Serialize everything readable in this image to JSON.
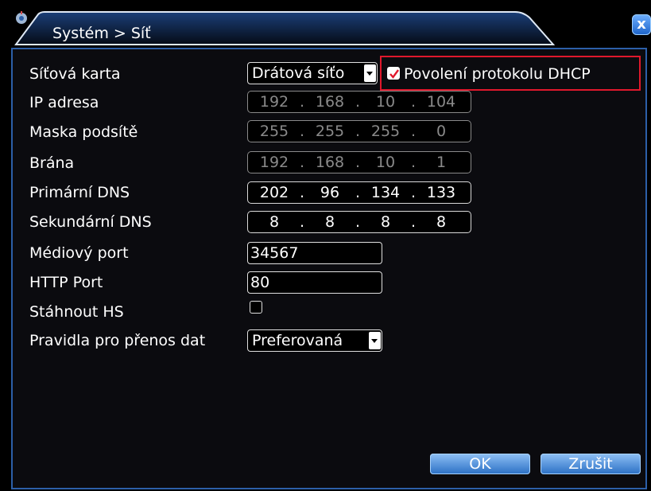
{
  "window": {
    "title": "Systém > Síť",
    "close_label": "x"
  },
  "form": {
    "network_card": {
      "label": "Síťová karta",
      "value": "Drátová síťo"
    },
    "dhcp": {
      "label": "Povolení protokolu DHCP",
      "checked": true
    },
    "ip_address": {
      "label": "IP adresa",
      "octets": [
        "192",
        "168",
        "10",
        "104"
      ],
      "enabled": false
    },
    "subnet_mask": {
      "label": "Maska podsítě",
      "octets": [
        "255",
        "255",
        "255",
        "0"
      ],
      "enabled": false
    },
    "gateway": {
      "label": "Brána",
      "octets": [
        "192",
        "168",
        "10",
        "1"
      ],
      "enabled": false
    },
    "primary_dns": {
      "label": "Primární DNS",
      "octets": [
        "202",
        "96",
        "134",
        "133"
      ],
      "enabled": true
    },
    "secondary_dns": {
      "label": "Sekundární DNS",
      "octets": [
        "8",
        "8",
        "8",
        "8"
      ],
      "enabled": true
    },
    "media_port": {
      "label": "Médiový port",
      "value": "34567"
    },
    "http_port": {
      "label": "HTTP Port",
      "value": "80"
    },
    "download_hs": {
      "label": "Stáhnout HS",
      "checked": false
    },
    "transfer_rules": {
      "label": "Pravidla pro přenos dat",
      "value": "Preferovaná"
    }
  },
  "buttons": {
    "ok": "OK",
    "cancel": "Zrušit"
  },
  "colors": {
    "accent_blue": "#2c5fa8",
    "highlight_red": "#e0182c",
    "disabled_gray": "#8a8a8a"
  }
}
